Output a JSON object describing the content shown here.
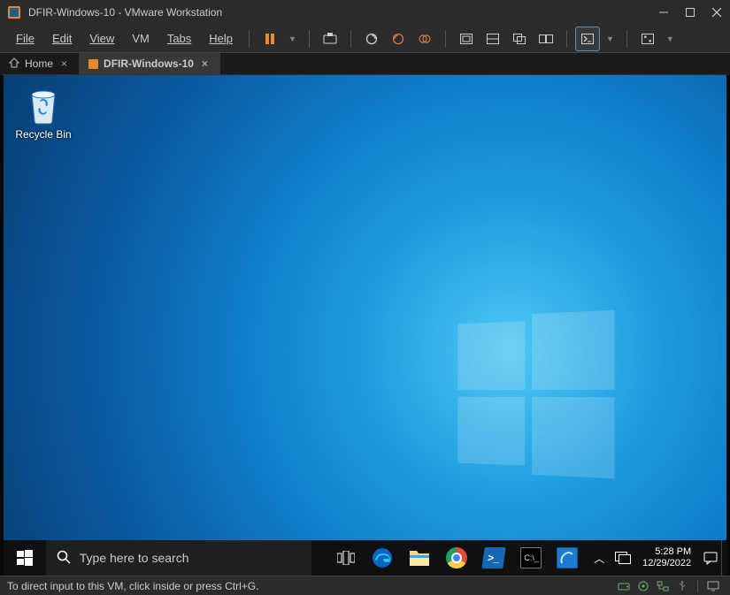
{
  "window": {
    "title": "DFIR-Windows-10 - VMware Workstation"
  },
  "menu": {
    "file": "File",
    "edit": "Edit",
    "view": "View",
    "vm": "VM",
    "tabs": "Tabs",
    "help": "Help"
  },
  "toolbar_icons": {
    "pause": "pause-icon",
    "send_cad": "send-ctrl-alt-del-icon",
    "snapshot_take": "snapshot-take-icon",
    "snapshot_revert": "snapshot-revert-icon",
    "snapshot_manager": "snapshot-manager-icon",
    "fit_guest": "fit-guest-icon",
    "fit_window": "fit-window-icon",
    "unity": "unity-icon",
    "multi_monitor": "multi-monitor-icon",
    "console": "console-view-icon",
    "fullscreen": "fullscreen-icon"
  },
  "tabs": {
    "home": "Home",
    "vm": "DFIR-Windows-10"
  },
  "desktop": {
    "recycle_bin": "Recycle Bin"
  },
  "taskbar": {
    "search_placeholder": "Type here to search"
  },
  "taskbar_items": {
    "task_view": "task-view-icon",
    "edge": "edge-icon",
    "explorer": "file-explorer-icon",
    "chrome": "chrome-icon",
    "powershell": "powershell-icon",
    "cmd": "cmd-icon",
    "ftk": "ftk-imager-icon"
  },
  "tray": {
    "overflow": "tray-overflow-icon",
    "display": "display-connect-icon",
    "action_center": "action-center-icon"
  },
  "clock": {
    "time": "5:28 PM",
    "date": "12/29/2022"
  },
  "statusbar": {
    "message": "To direct input to this VM, click inside or press Ctrl+G.",
    "devices": {
      "hdd": "hard-disk-icon",
      "cd": "cd-dvd-icon",
      "net": "network-adapter-icon",
      "usb": "usb-icon",
      "sound": "display-icon"
    }
  }
}
